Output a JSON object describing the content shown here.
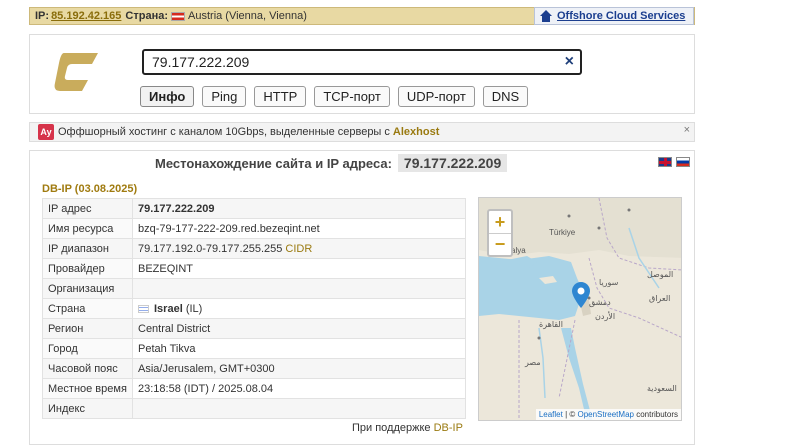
{
  "topbar": {
    "ip_label": "IP:",
    "ip_value": "85.192.42.165",
    "country_label": "Страна:",
    "country_value": "Austria (Vienna, Vienna)",
    "offshore_label": "Offshore Cloud Services"
  },
  "search": {
    "value": "79.177.222.209",
    "clear": "×"
  },
  "tabs": [
    "Инфо",
    "Ping",
    "HTTP",
    "TCP-порт",
    "UDP-порт",
    "DNS"
  ],
  "ad": {
    "icon": "Ay",
    "text": "Оффшорный хостинг с каналом 10Gbps, выделенные серверы с",
    "link": "Alexhost",
    "close": "×"
  },
  "panel": {
    "title": "Местонахождение сайта и IP адреса:",
    "ip": "79.177.222.209",
    "source": "DB-IP (03.08.2025)"
  },
  "rows": [
    {
      "k": "IP адрес",
      "v": "79.177.222.209"
    },
    {
      "k": "Имя ресурса",
      "v": "bzq-79-177-222-209.red.bezeqint.net"
    },
    {
      "k": "IP диапазон",
      "v": "79.177.192.0-79.177.255.255",
      "extra": "CIDR"
    },
    {
      "k": "Провайдер",
      "v": "BEZEQINT"
    },
    {
      "k": "Организация",
      "v": ""
    },
    {
      "k": "Страна",
      "v": "Israel",
      "extra": "(IL)"
    },
    {
      "k": "Регион",
      "v": "Central District"
    },
    {
      "k": "Город",
      "v": "Petah Tikva"
    },
    {
      "k": "Часовой пояс",
      "v": "Asia/Jerusalem, GMT+0300"
    },
    {
      "k": "Местное время",
      "v": "23:18:58 (IDT) / 2025.08.04"
    },
    {
      "k": "Индекс",
      "v": ""
    }
  ],
  "support": {
    "text": "При поддержке",
    "link": "DB-IP"
  },
  "map": {
    "zoom_in": "+",
    "zoom_out": "−",
    "attrib_leaflet": "Leaflet",
    "attrib_sep": " | © ",
    "attrib_osm": "OpenStreetMap",
    "attrib_tail": " contributors",
    "labels": {
      "turkiye": "Türkiye",
      "antalya": "Antalya",
      "mosul": "الموصل",
      "syria": "سوريا",
      "iraq": "العراق",
      "damascus": "دمشق",
      "jordan": "الأردن",
      "cairo": "القاهرة",
      "egypt": "مصر",
      "saudi": "السعودية"
    }
  }
}
